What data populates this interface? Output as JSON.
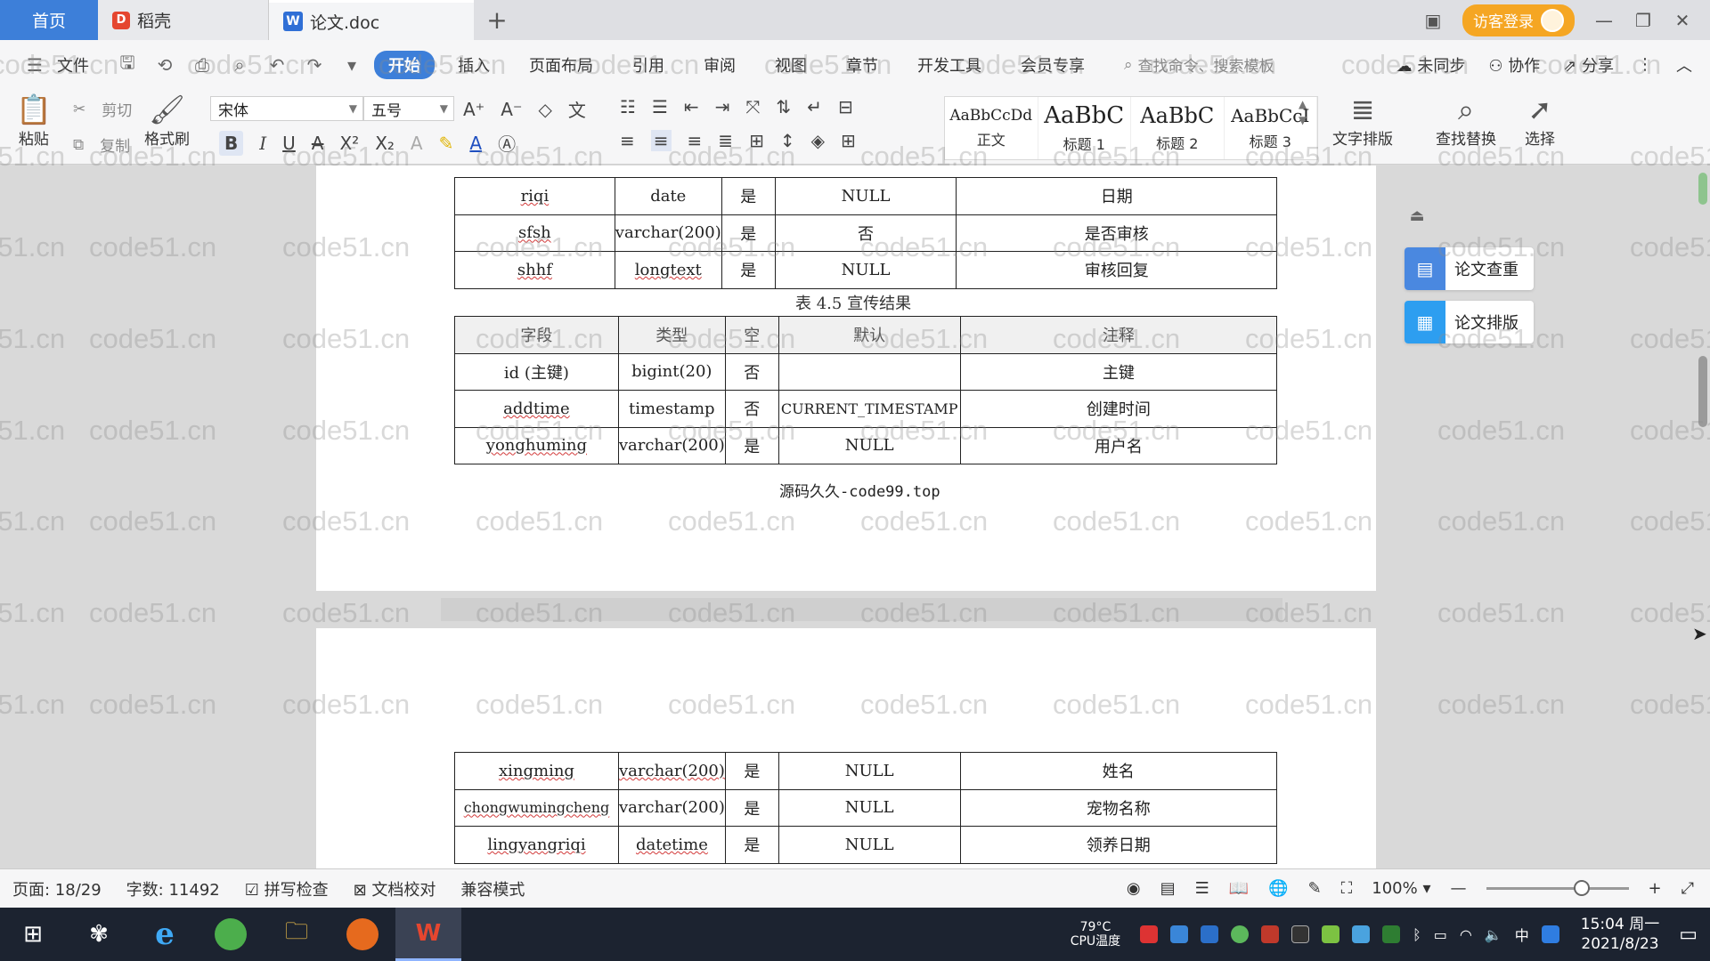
{
  "titlebar": {
    "home_tab": "首页",
    "daoke_tab": "稻壳",
    "doc_tab": "论文.doc",
    "add_tab": "+",
    "visitor_login": "访客登录"
  },
  "menubar": {
    "file": "文件",
    "items": [
      "开始",
      "插入",
      "页面布局",
      "引用",
      "审阅",
      "视图",
      "章节",
      "开发工具",
      "会员专享"
    ],
    "search_placeholder": "查找命令、搜索模板",
    "not_synced": "未同步",
    "collaborate": "协作",
    "share": "分享"
  },
  "ribbon": {
    "paste": "粘贴",
    "cut": "剪切",
    "copy": "复制",
    "format_painter": "格式刷",
    "font_name": "宋体",
    "font_size": "五号",
    "styles": [
      {
        "sample": "AaBbCcDd",
        "name": "正文"
      },
      {
        "sample": "AaBbC",
        "name": "标题 1"
      },
      {
        "sample": "AaBbC",
        "name": "标题 2"
      },
      {
        "sample": "AaBbCcI",
        "name": "标题 3"
      }
    ],
    "text_layout": "文字排版",
    "find_replace": "查找替换",
    "select": "选择"
  },
  "document": {
    "table1_rows": [
      [
        "riqi",
        "date",
        "是",
        "NULL",
        "日期"
      ],
      [
        "sfsh",
        "varchar(200)",
        "是",
        "否",
        "是否审核"
      ],
      [
        "shhf",
        "longtext",
        "是",
        "NULL",
        "审核回复"
      ]
    ],
    "table2_caption": "表 4.5  宣传结果",
    "table2_header": [
      "字段",
      "类型",
      "空",
      "默认",
      "注释"
    ],
    "table2_rows": [
      [
        "id (主键)",
        "bigint(20)",
        "否",
        "",
        "主键"
      ],
      [
        "addtime",
        "timestamp",
        "否",
        "CURRENT_TIMESTAMP",
        "创建时间"
      ],
      [
        "yonghuming",
        "varchar(200)",
        "是",
        "NULL",
        "用户名"
      ]
    ],
    "source_line": "源码久久-code99.top",
    "table3_rows": [
      [
        "xingming",
        "varchar(200)",
        "是",
        "NULL",
        "姓名"
      ],
      [
        "chongwumingcheng",
        "varchar(200)",
        "是",
        "NULL",
        "宠物名称"
      ],
      [
        "lingyangriqi",
        "datetime",
        "是",
        "NULL",
        "领养日期"
      ]
    ],
    "watermark": "code51.cn"
  },
  "side_panel": {
    "check": "论文查重",
    "layout": "论文排版"
  },
  "statusbar": {
    "page": "页面: 18/29",
    "words": "字数: 11492",
    "spellcheck": "拼写检查",
    "doc_proof": "文档校对",
    "compat_mode": "兼容模式",
    "zoom": "100%"
  },
  "taskbar": {
    "temperature": "79°C",
    "cpu_label": "CPU温度",
    "ime": "中",
    "time": "15:04 周一",
    "date": "2021/8/23"
  },
  "colors": {
    "accent": "#3d7fd9",
    "visitor": "#f5a623",
    "taskbar": "#1c2330"
  }
}
